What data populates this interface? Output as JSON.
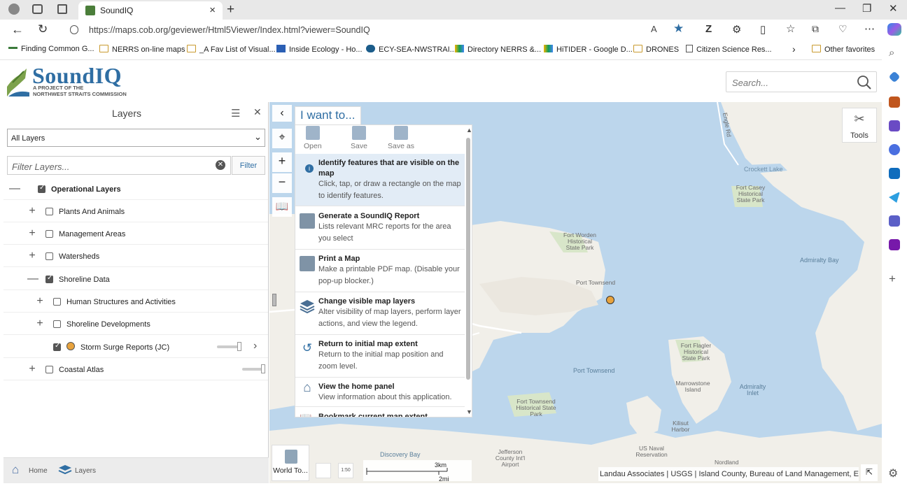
{
  "browser": {
    "tab_title": "SoundIQ",
    "url": "https://maps.cob.org/geviewer/Html5Viewer/Index.html?viewer=SoundIQ",
    "favorites": [
      "Finding Common G...",
      "NERRS on-line maps",
      "_A Fav List of Visual...",
      "Inside Ecology - Ho...",
      "ECY-SEA-NWSTRAI...",
      "Directory NERRS &...",
      "HiTIDER - Google D...",
      "DRONES",
      "Citizen Science Res..."
    ],
    "other_favorites": "Other favorites"
  },
  "app": {
    "logo_title": "SoundIQ",
    "logo_sub1": "A PROJECT OF THE",
    "logo_sub2": "NORTHWEST STRAITS COMMISSION",
    "search_placeholder": "Search..."
  },
  "layers_panel": {
    "title": "Layers",
    "select_value": "All Layers",
    "filter_placeholder": "Filter Layers...",
    "filter_button": "Filter",
    "layers": [
      {
        "label": "Operational Layers",
        "toggle": "—",
        "checked": true,
        "bold": true
      },
      {
        "label": "Plants And Animals",
        "toggle": "+",
        "checked": false
      },
      {
        "label": "Management Areas",
        "toggle": "+",
        "checked": false
      },
      {
        "label": "Watersheds",
        "toggle": "+",
        "checked": false
      },
      {
        "label": "Shoreline Data",
        "toggle": "—",
        "checked": true
      },
      {
        "label": "Human Structures and Activities",
        "toggle": "+",
        "checked": false
      },
      {
        "label": "Shoreline Developments",
        "toggle": "+",
        "checked": false
      },
      {
        "label": "Storm Surge Reports (JC)",
        "toggle": "",
        "checked": true
      },
      {
        "label": "Coastal Atlas",
        "toggle": "+",
        "checked": false
      }
    ],
    "bottom_tabs": [
      "Home",
      "Layers"
    ]
  },
  "iwant": {
    "header": "I want to...",
    "top_buttons": [
      "Open",
      "Save",
      "Save as"
    ],
    "items": [
      {
        "title": "Identify features that are visible on the map",
        "desc": "Click, tap, or draw a rectangle on the map to identify features."
      },
      {
        "title": "Generate a SoundIQ Report",
        "desc": "Lists relevant MRC reports for the area you select"
      },
      {
        "title": "Print a Map",
        "desc": "Make a printable PDF map. (Disable your pop-up blocker.)"
      },
      {
        "title": "Change visible map layers",
        "desc": "Alter visibility of map layers, perform layer actions, and view the legend."
      },
      {
        "title": "Return to initial map extent",
        "desc": "Return to the initial map position and zoom level."
      },
      {
        "title": "View the home panel",
        "desc": "View information about this application."
      },
      {
        "title": "Bookmark current map extent",
        "desc": ""
      }
    ]
  },
  "map": {
    "tools_label": "Tools",
    "world_to_label": "World To...",
    "scale_km": "3km",
    "scale_mi": "2mi",
    "attribution": "Landau Associates | USGS | Island County, Bureau of Land Management, Esri C",
    "labels": [
      "Crockett Lake",
      "Fort Casey Historical State Park",
      "Fort Worden Historical State Park",
      "Port Townsend",
      "Admiralty Bay",
      "Port Townsend",
      "Fort Flagler Historical State Park",
      "Marrowstone Island",
      "Admiralty Inlet",
      "Kilisut Harbor",
      "Fort Townsend Historical State Park",
      "Discovery Bay",
      "Jefferson County Int'l Airport",
      "US Naval Reservation",
      "Nordland",
      "Engle Rd"
    ]
  },
  "colors": {
    "accent": "#2f6ea3",
    "water": "#bcd6ec",
    "land": "#f1efe9",
    "marker": "#e8a33d"
  }
}
